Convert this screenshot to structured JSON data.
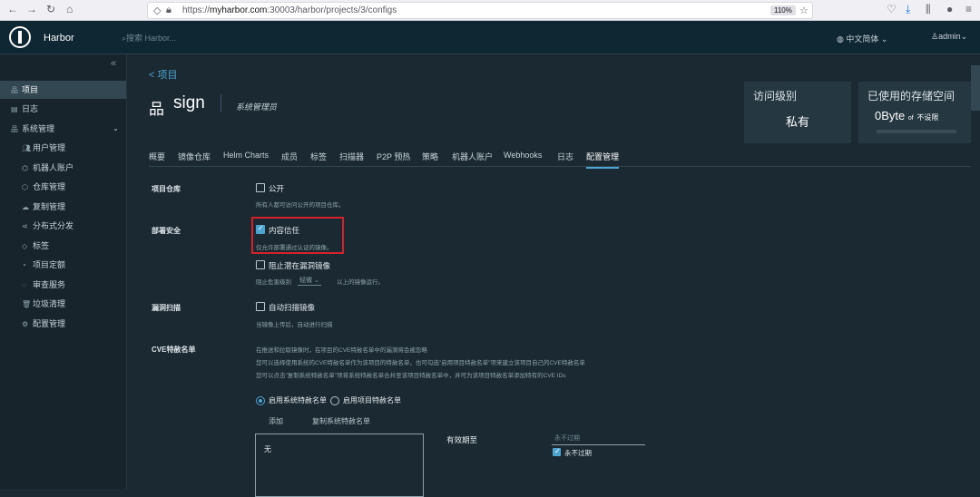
{
  "browser": {
    "url_prefix": "https://",
    "url_host": "myharbor.com",
    "url_rest": ":30003/harbor/projects/3/configs",
    "zoom": "110%"
  },
  "header": {
    "brand": "Harbor",
    "search_placeholder": "搜索 Harbor...",
    "language": "中文简体",
    "user": "admin"
  },
  "sidebar": {
    "items": [
      {
        "label": "项目"
      },
      {
        "label": "日志"
      },
      {
        "label": "系统管理"
      },
      {
        "label": "用户管理"
      },
      {
        "label": "机器人账户"
      },
      {
        "label": "仓库管理"
      },
      {
        "label": "复制管理"
      },
      {
        "label": "分布式分发"
      },
      {
        "label": "标签"
      },
      {
        "label": "项目定额"
      },
      {
        "label": "审查服务"
      },
      {
        "label": "垃圾清理"
      },
      {
        "label": "配置管理"
      }
    ]
  },
  "project": {
    "back": "< 项目",
    "name": "sign",
    "role": "系统管理员"
  },
  "cards": {
    "access_title": "访问级别",
    "access_value": "私有",
    "storage_title": "已使用的存储空间",
    "storage_value": "0Byte",
    "storage_of": "of",
    "storage_limit": "不设限"
  },
  "tabs": [
    "概要",
    "镜像仓库",
    "Helm Charts",
    "成员",
    "标签",
    "扫描器",
    "P2P 预热",
    "策略",
    "机器人账户",
    "Webhooks",
    "日志",
    "配置管理"
  ],
  "config": {
    "repo_label": "项目仓库",
    "public_label": "公开",
    "public_hint": "所有人都可访问公开的项目仓库。",
    "deploy_label": "部署安全",
    "trust_label": "内容信任",
    "trust_hint": "仅允许部署通过认证的镜像。",
    "prevent_label": "阻止潜在漏洞镜像",
    "prevent_hint_pre": "阻止危害级别",
    "prevent_severity": "轻微",
    "prevent_hint_post": "以上的镜像运行。",
    "scan_label": "漏洞扫描",
    "autoscan_label": "自动扫描镜像",
    "autoscan_hint": "当镜像上传后，自动进行扫描",
    "cve_label": "CVE特赦名单",
    "cve_line1": "在推送和拉取镜像时，在项目的CVE特赦名单中的漏洞将会被忽略",
    "cve_line2": "您可以选择使用系统的CVE特赦名单作为该项目的特赦名单，也可勾选\"启用项目特赦名单\"项来建立该项目自己的CVE特赦名单",
    "cve_line3": "您可以点击\"复制系统特赦名单\"项将系统特赦名单合并至该项目特赦名单中，并可为该项目特赦名单添加特有的CVE IDs",
    "radio_system": "启用系统特赦名单",
    "radio_project": "启用项目特赦名单",
    "add_label": "添加",
    "copy_label": "复制系统特赦名单",
    "list_empty": "无",
    "expire_label": "有效期至",
    "expire_placeholder": "永不过期",
    "never_expire_label": "永不过期"
  }
}
